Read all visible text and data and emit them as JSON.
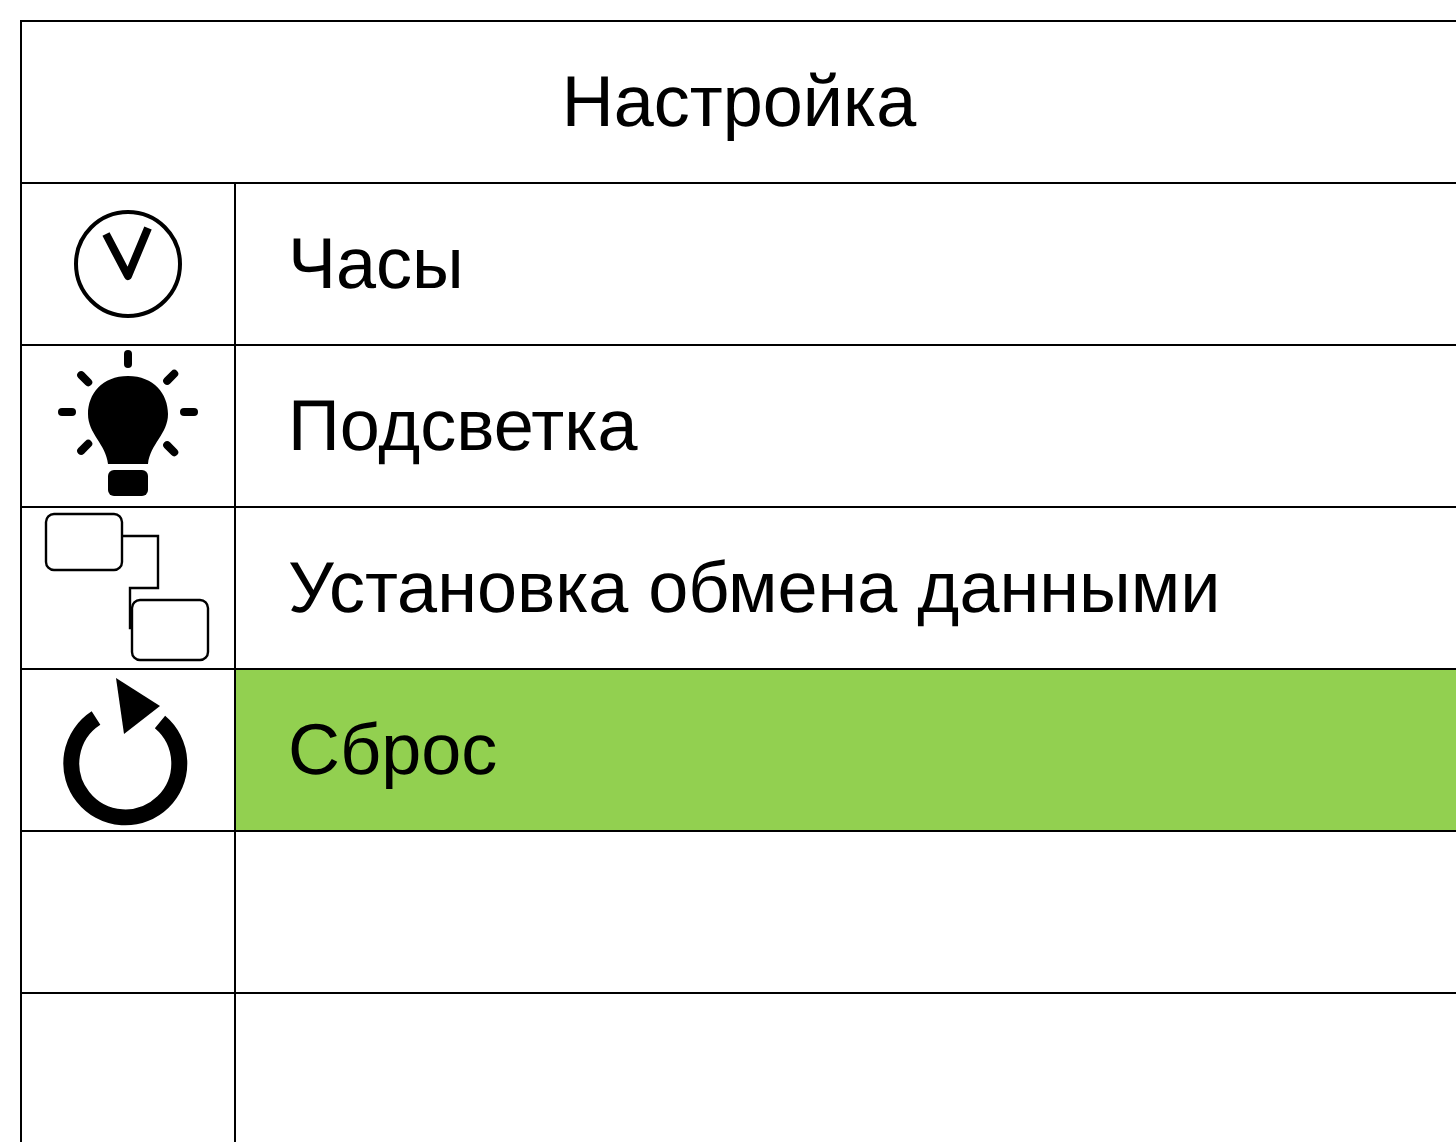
{
  "title": "Настройка",
  "items": [
    {
      "kind": "clock",
      "label": "Часы",
      "selected": false
    },
    {
      "kind": "bulb",
      "label": "Подсветка",
      "selected": false
    },
    {
      "kind": "link",
      "label": "Установка обмена данными",
      "selected": false
    },
    {
      "kind": "reset",
      "label": "Сброс",
      "selected": true
    }
  ]
}
